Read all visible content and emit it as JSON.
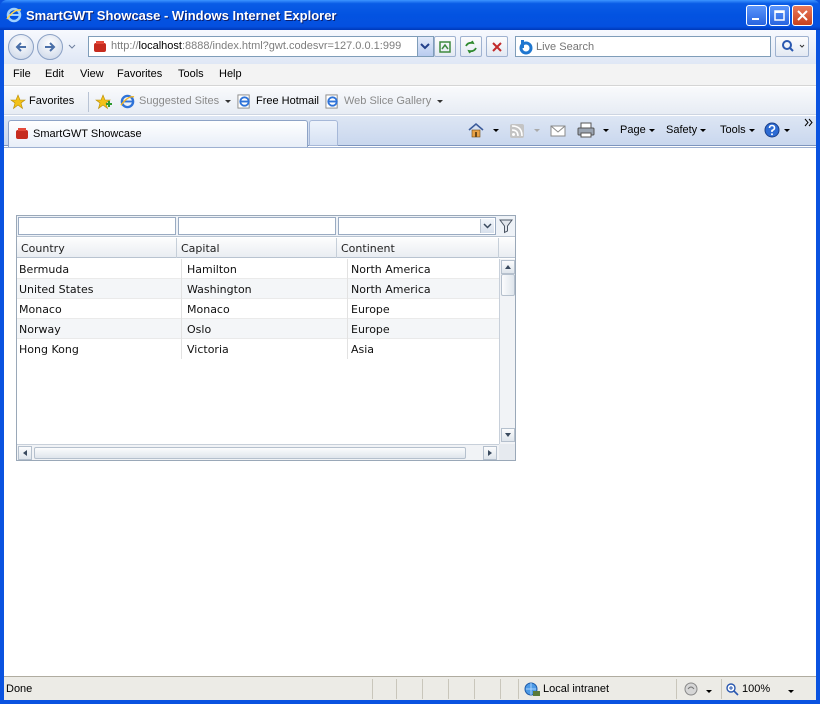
{
  "window": {
    "title": "SmartGWT Showcase - Windows Internet Explorer"
  },
  "addressbar": {
    "url_prefix": "http://",
    "url_host": "localhost",
    "url_rest": ":8888/index.html?gwt.codesvr=127.0.0.1:999",
    "search_placeholder": "Live Search"
  },
  "menu": [
    "File",
    "Edit",
    "View",
    "Favorites",
    "Tools",
    "Help"
  ],
  "favorites_bar": {
    "favorites": "Favorites",
    "suggested": "Suggested Sites",
    "hotmail": "Free Hotmail",
    "webslice": "Web Slice Gallery"
  },
  "tab": {
    "label": "SmartGWT Showcase"
  },
  "commands": {
    "page": "Page",
    "safety": "Safety",
    "tools": "Tools"
  },
  "grid": {
    "columns": [
      "Country",
      "Capital",
      "Continent"
    ],
    "rows": [
      [
        "Bermuda",
        "Hamilton",
        "North America"
      ],
      [
        "United States",
        "Washington",
        "North America"
      ],
      [
        "Monaco",
        "Monaco",
        "Europe"
      ],
      [
        "Norway",
        "Oslo",
        "Europe"
      ],
      [
        "Hong Kong",
        "Victoria",
        "Asia"
      ]
    ]
  },
  "status": {
    "text": "Done",
    "zone": "Local intranet",
    "zoom": "100%"
  },
  "colors": {
    "titlebar": "#0353e1",
    "grid_border": "#9aa8b8"
  }
}
